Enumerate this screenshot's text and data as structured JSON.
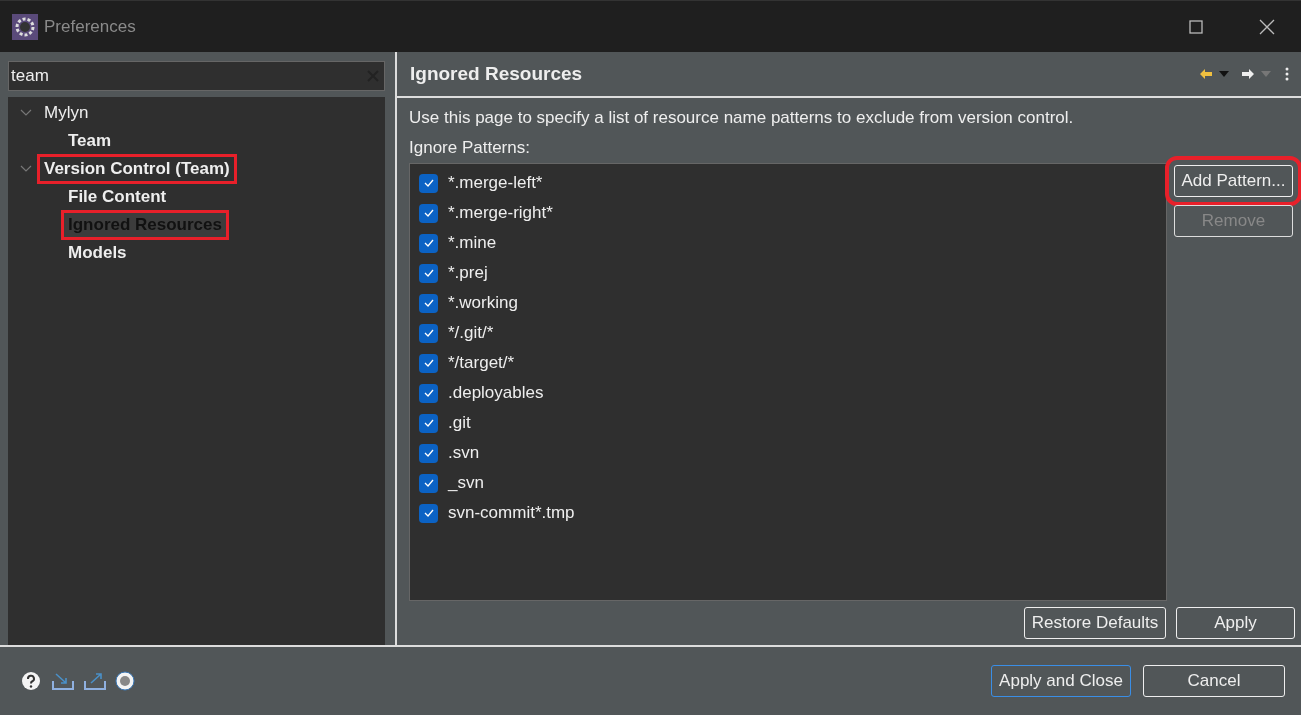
{
  "window": {
    "title": "Preferences"
  },
  "filter": {
    "value": "team"
  },
  "tree": [
    {
      "label": "Mylyn",
      "bold": false,
      "selected": false,
      "highlighted": false,
      "expanded": true,
      "children": [
        {
          "label": "Team",
          "bold": true,
          "selected": false,
          "highlighted": false
        }
      ]
    },
    {
      "label": "Version Control (Team)",
      "bold": true,
      "selected": false,
      "highlighted": true,
      "expanded": true,
      "children": [
        {
          "label": "File Content",
          "bold": true,
          "selected": false,
          "highlighted": false
        },
        {
          "label": "Ignored Resources",
          "bold": true,
          "selected": true,
          "highlighted": true
        },
        {
          "label": "Models",
          "bold": true,
          "selected": false,
          "highlighted": false
        }
      ]
    }
  ],
  "page": {
    "title": "Ignored Resources",
    "description": "Use this page to specify a list of resource name patterns to exclude from version control.",
    "list_label": "Ignore Patterns:",
    "patterns": [
      {
        "label": "*.merge-left*",
        "checked": true
      },
      {
        "label": "*.merge-right*",
        "checked": true
      },
      {
        "label": "*.mine",
        "checked": true
      },
      {
        "label": "*.prej",
        "checked": true
      },
      {
        "label": "*.working",
        "checked": true
      },
      {
        "label": "*/.git/*",
        "checked": true
      },
      {
        "label": "*/target/*",
        "checked": true
      },
      {
        "label": ".deployables",
        "checked": true
      },
      {
        "label": ".git",
        "checked": true
      },
      {
        "label": ".svn",
        "checked": true
      },
      {
        "label": "_svn",
        "checked": true
      },
      {
        "label": "svn-commit*.tmp",
        "checked": true
      }
    ],
    "side_buttons": [
      {
        "label": "Add Pattern...",
        "disabled": false,
        "highlighted": true
      },
      {
        "label": "Remove",
        "disabled": true,
        "highlighted": false
      }
    ],
    "bottom_buttons": [
      {
        "label": "Restore Defaults",
        "disabled": false
      },
      {
        "label": "Apply",
        "disabled": false
      }
    ]
  },
  "dialog_buttons": [
    {
      "label": "Apply and Close",
      "default": true
    },
    {
      "label": "Cancel",
      "default": false
    }
  ]
}
